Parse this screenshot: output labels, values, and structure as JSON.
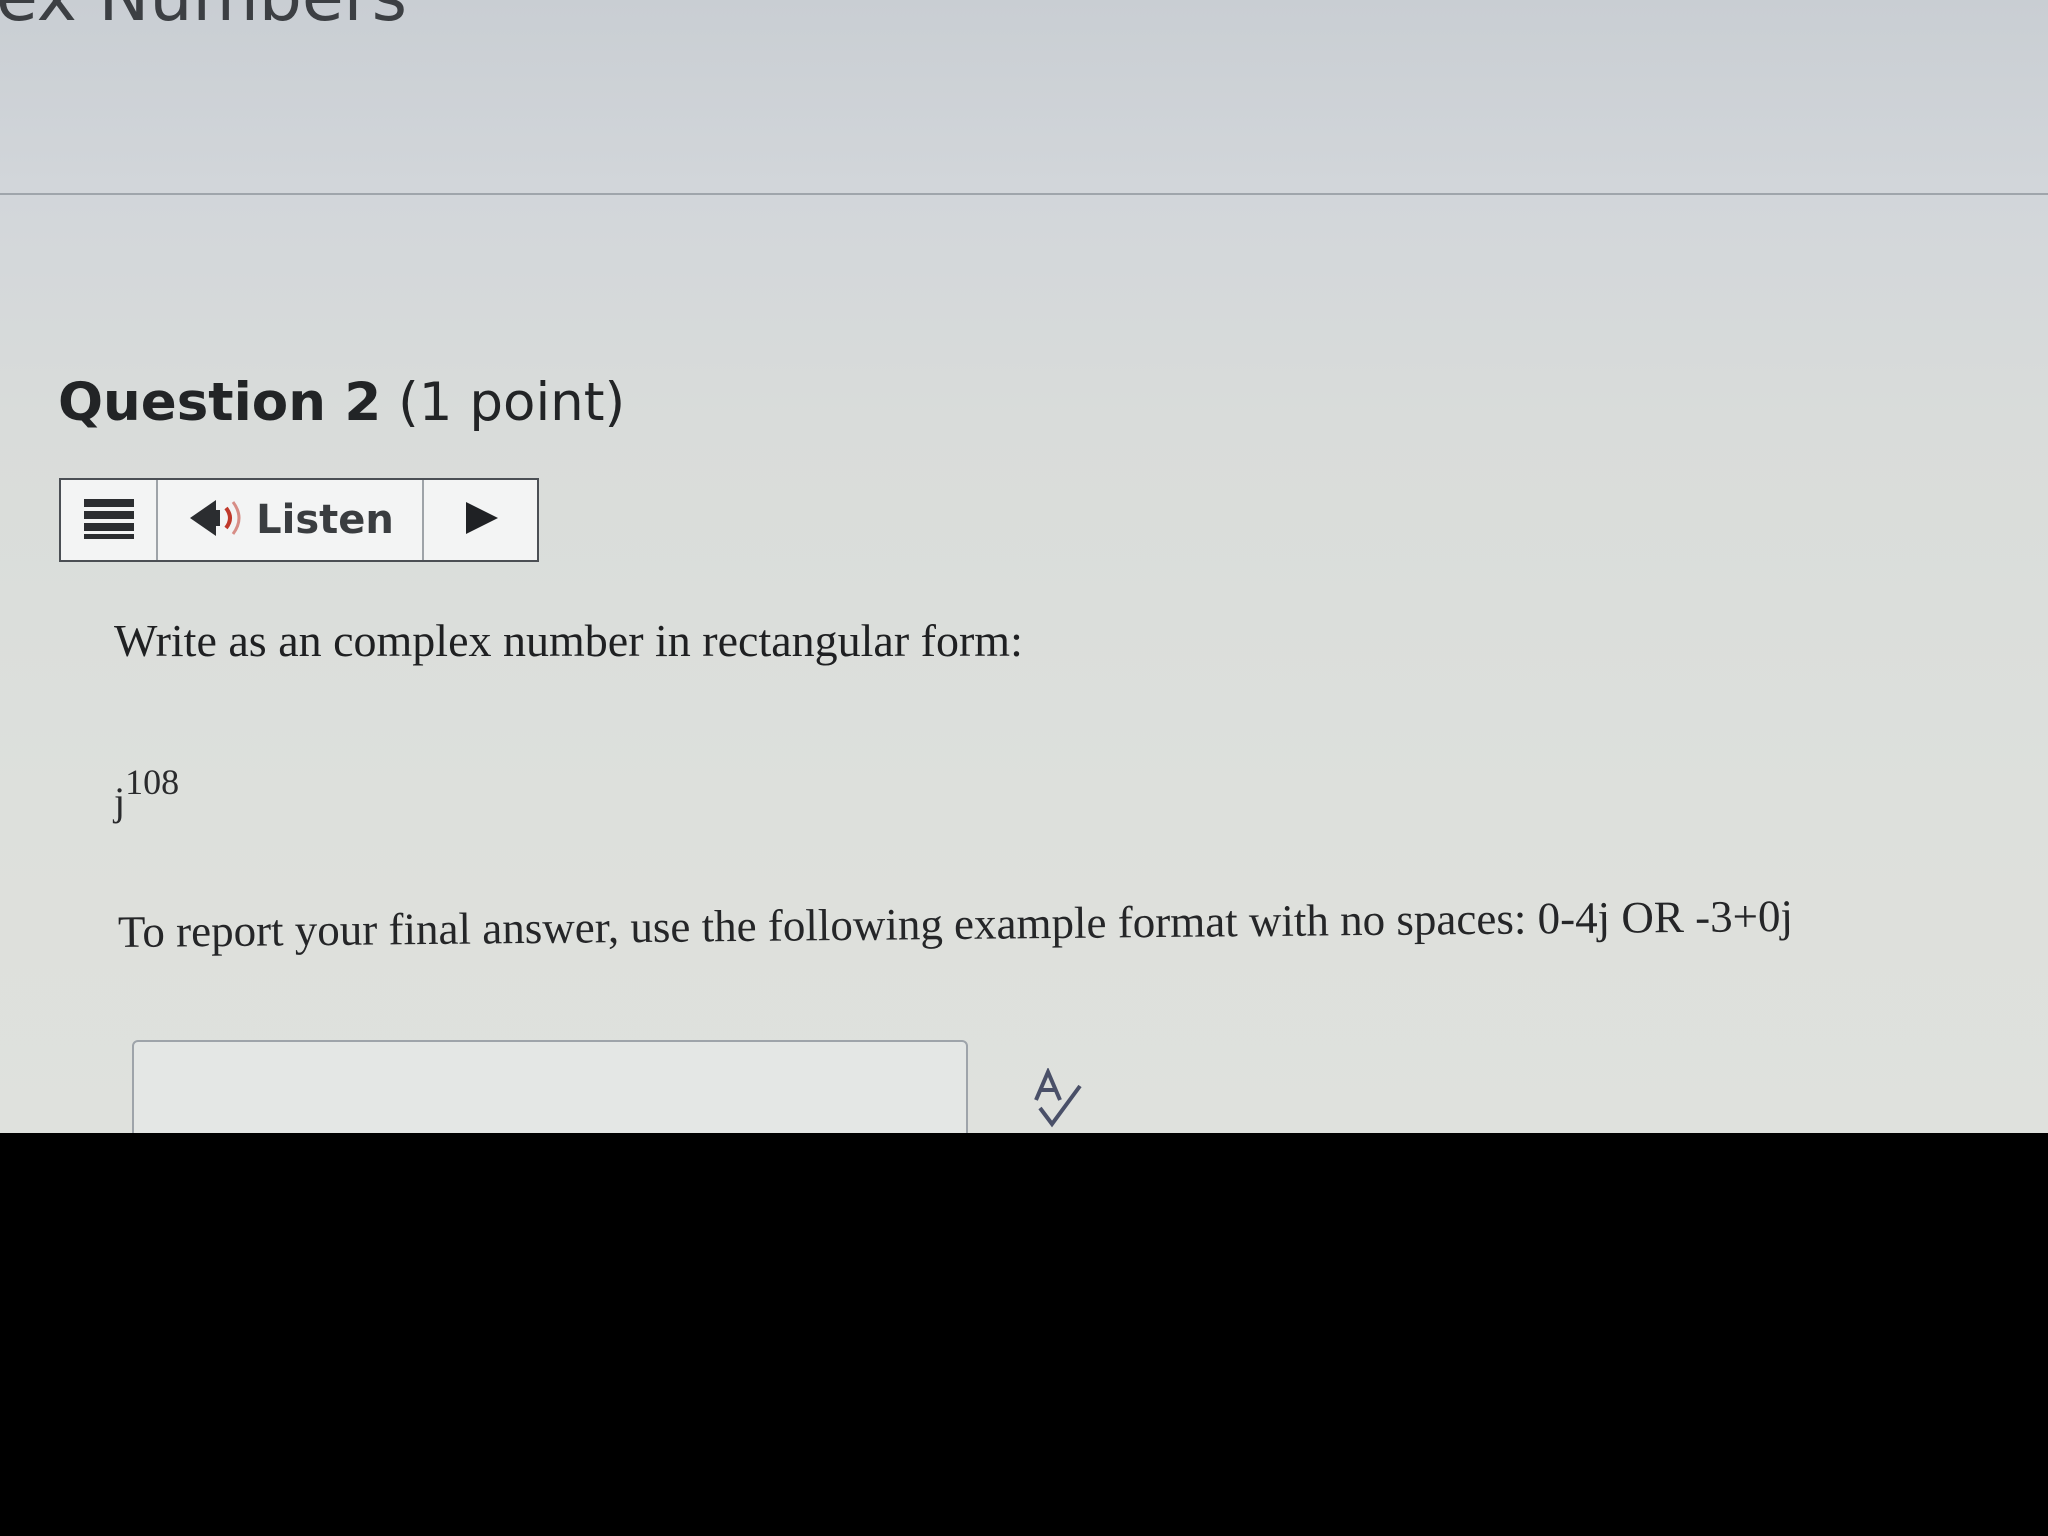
{
  "page": {
    "heading_fragment": "ex Numbers"
  },
  "question": {
    "number_label": "Question 2",
    "points_label": "(1 point)"
  },
  "toolbar": {
    "menu_icon": "menu-icon",
    "speaker_icon": "speaker-icon",
    "listen_label": "Listen",
    "play_icon": "play-icon"
  },
  "content": {
    "prompt": "Write as an complex number in rectangular form:",
    "expression_base": "j",
    "expression_exponent": "108",
    "format_instruction": "To report your final answer, use the following example format with no spaces: 0-4j OR -3+0j"
  },
  "answer": {
    "value": "",
    "placeholder": ""
  },
  "colors": {
    "speaker_accent": "#c0392b",
    "text": "#222426"
  }
}
